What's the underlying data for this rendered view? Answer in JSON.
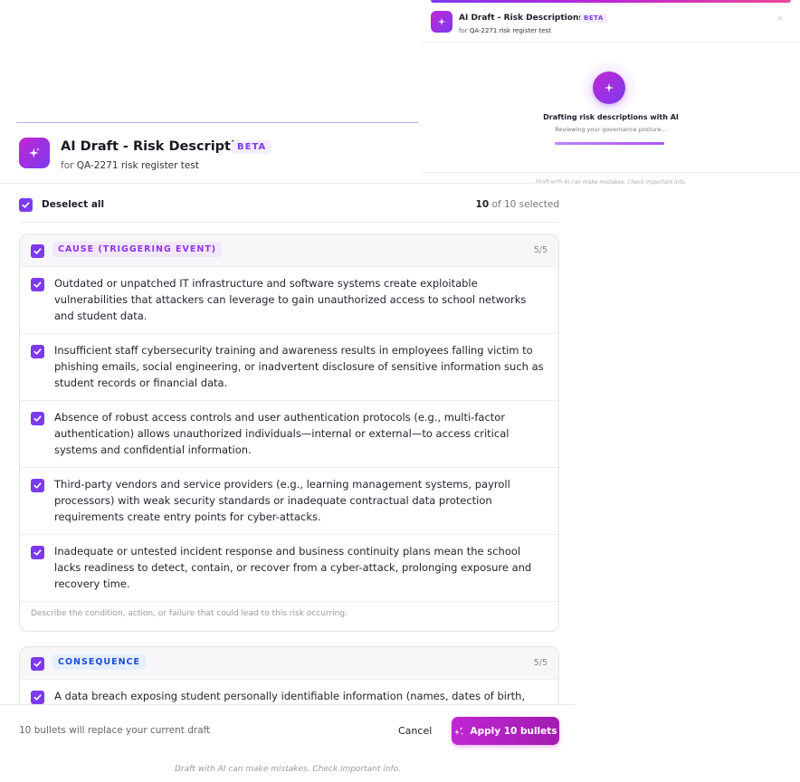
{
  "mini_modal": {
    "title": "AI Draft - Risk Descriptions",
    "beta": "BETA",
    "for_prefix": "for",
    "ref": "QA-2271 risk register test",
    "close": "×",
    "status": "Drafting risk descriptions with AI",
    "status_sub": "Reviewing your governance posture…",
    "progress": 1.0,
    "disclaimer": "Draft with AI can make mistakes. Check important info."
  },
  "header": {
    "title": "AI Draft - Risk Descriptions",
    "beta": "BETA",
    "for_prefix": "for",
    "ref": "QA-2271 risk register test"
  },
  "selection": {
    "deselect_label": "Deselect all",
    "selected": "10",
    "of_total": "of 10 selected"
  },
  "sections": [
    {
      "tag": "CAUSE (TRIGGERING EVENT)",
      "count": "5/5",
      "items": [
        "Outdated or unpatched IT infrastructure and software systems create exploitable vulnerabilities that attackers can leverage to gain unauthorized access to school networks and student data.",
        "Insufficient staff cybersecurity training and awareness results in employees falling victim to phishing emails, social engineering, or inadvertent disclosure of sensitive information such as student records or financial data.",
        "Absence of robust access controls and user authentication protocols (e.g., multi-factor authentication) allows unauthorized individuals—internal or external—to access critical systems and confidential information.",
        "Third-party vendors and service providers (e.g., learning management systems, payroll processors) with weak security standards or inadequate contractual data protection requirements create entry points for cyber-attacks.",
        "Inadequate or untested incident response and business continuity plans mean the school lacks readiness to detect, contain, or recover from a cyber-attack, prolonging exposure and recovery time."
      ],
      "hint": "Describe the condition, action, or failure that could lead to this risk occurring."
    },
    {
      "tag": "CONSEQUENCE",
      "count": "5/5",
      "items": [
        "A data breach exposing student personally identifiable information (names, dates of birth,"
      ]
    }
  ],
  "footer": {
    "note": "10 bullets will replace your current draft",
    "cancel": "Cancel",
    "apply": "Apply 10 bullets"
  },
  "disclaimer": "Draft with AI can make mistakes. Check important info.",
  "colors": {
    "accent": "#7c3aed",
    "brand_gradient_start": "#c026d3",
    "brand_gradient_end": "#7c3aed"
  },
  "icons": {
    "logo": "sparkle-icon",
    "check": "checkmark-icon",
    "apply": "sparkles-icon",
    "close": "close-icon"
  }
}
